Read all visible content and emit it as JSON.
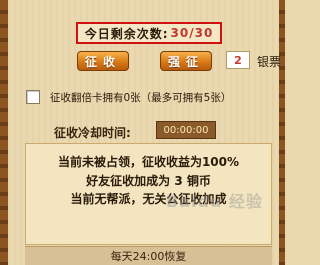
{
  "collection": {
    "count_label": "今日剩余次数:",
    "count_value": "30/30"
  },
  "actions": {
    "collect_label": "征收",
    "force_label": "强征",
    "silver_amount": "2",
    "silver_unit": "银票"
  },
  "double_card": {
    "text": "征收翻倍卡拥有0张（最多可拥有5张）",
    "checked": false
  },
  "cooldown": {
    "label": "征收冷却时间:",
    "value": "00:00:00"
  },
  "info": {
    "line1": "当前未被占领，征收收益为100%",
    "line2": "好友征收加成为 3 铜币",
    "line3": "当前无帮派，无关公征收加成"
  },
  "reset_text": "每天24:00恢复",
  "watermark": "Baidu 经验",
  "colors": {
    "highlight_border": "#d11010",
    "button_orange": "#d97a16",
    "count_red": "#c0392b"
  }
}
